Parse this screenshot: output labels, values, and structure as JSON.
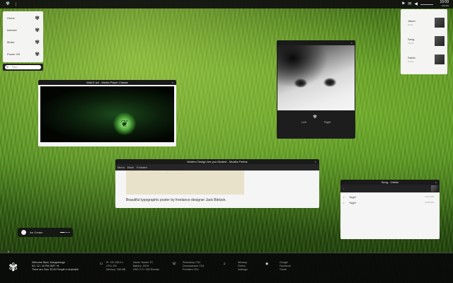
{
  "topbar": {
    "clock_time": "10:09",
    "clock_date": "22/1/09"
  },
  "launcher": {
    "items": [
      {
        "label": "Home"
      },
      {
        "label": "Internet"
      },
      {
        "label": "Music"
      },
      {
        "label": "Power Off"
      }
    ],
    "search_placeholder": "Run..."
  },
  "contacts": [
    {
      "name": "Jason",
      "status": "Away"
    },
    {
      "name": "Seng",
      "status": "Online"
    },
    {
      "name": "Sarah",
      "status": "Online"
    }
  ],
  "media_player": {
    "title": "Wall-E.avi - Media Player Classic"
  },
  "photo_viewer": {
    "prev_label": "Left",
    "next_label": "Right"
  },
  "browser": {
    "title": "Modern Design Are you Modest - Mozilla Firefox",
    "nav": [
      "Menu",
      "Back",
      "Forward"
    ],
    "caption": "Beautiful typographic poster by freelance designer Jack Bleksin."
  },
  "chat": {
    "title": "Seng - Online",
    "messages": [
      {
        "text": "*sigh*",
        "time": "10:04 PM"
      },
      {
        "text": "*sigh*",
        "time": "10:05 PM"
      }
    ]
  },
  "music": {
    "song": "Ice Cream",
    "progress": 0.45
  },
  "dock": {
    "tab_label": "ii",
    "welcome": [
      "Welcome Back, Mangobongo",
      "03 / 12 / 10 PM GMT +8",
      "There are Over 30,00 People in Australia!"
    ],
    "system": [
      "IP: 192.168.0.1",
      "CPU: 5%",
      "Memory: 256 MB"
    ],
    "computer": [
      "Name: Hauter-PC",
      "Battery: 100%",
      "HDD 173 / 400 Remain"
    ],
    "apps": [
      "Photoshop CS4",
      "Dreamweaver CS4",
      "Premiere CS4"
    ],
    "tools": [
      "Winamp",
      "Firefox",
      "Indesign"
    ],
    "links": [
      "Google",
      "Facebook",
      "Gmail"
    ]
  }
}
